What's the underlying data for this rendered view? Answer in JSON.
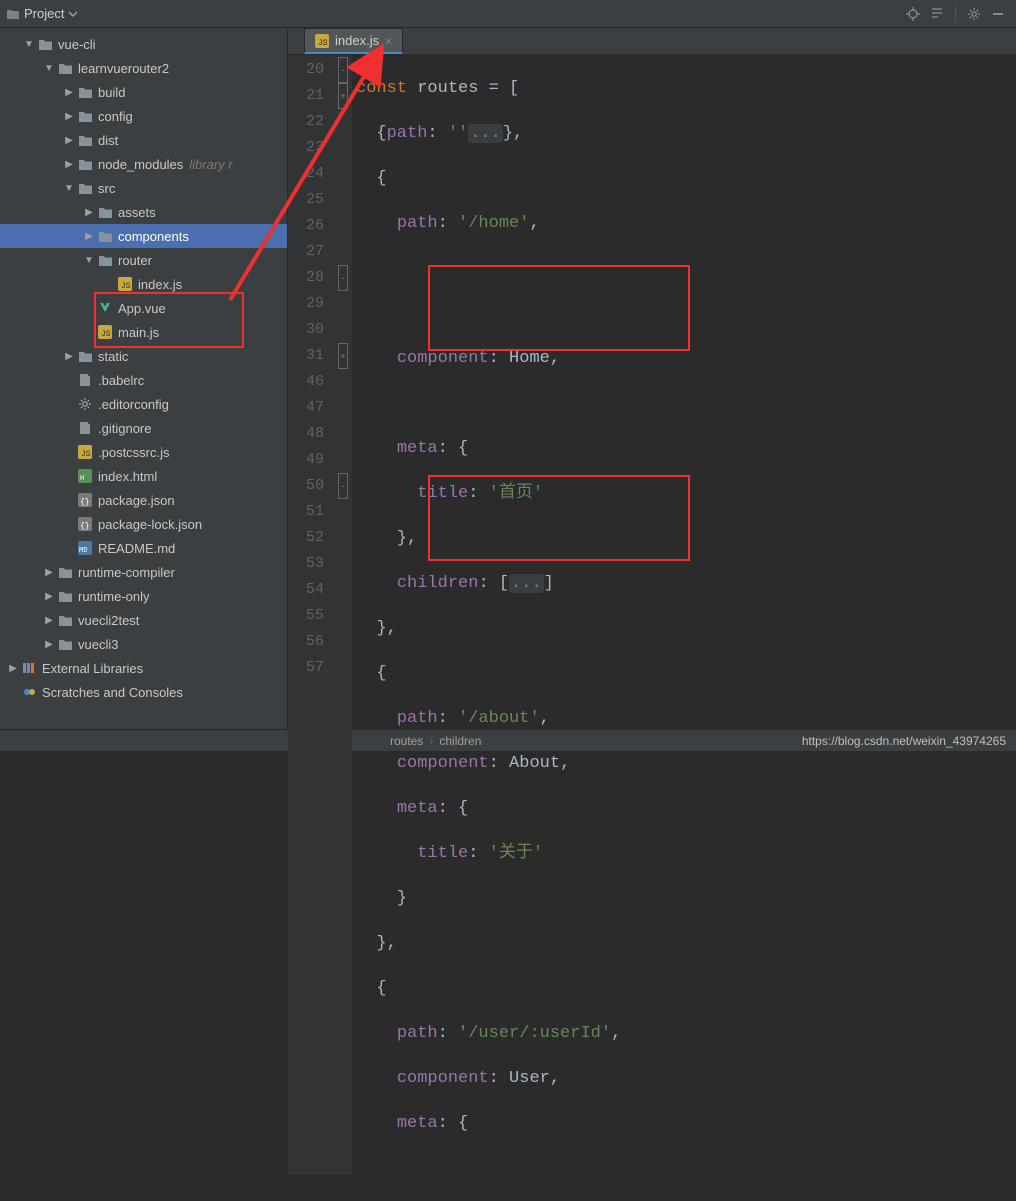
{
  "toolbar": {
    "title": "Project"
  },
  "tree": [
    {
      "ind": 1,
      "arrow": "down",
      "icon": "folder",
      "label": "vue-cli"
    },
    {
      "ind": 2,
      "arrow": "down",
      "icon": "folder",
      "label": "learnvuerouter2"
    },
    {
      "ind": 3,
      "arrow": "right",
      "icon": "folder",
      "label": "build"
    },
    {
      "ind": 3,
      "arrow": "right",
      "icon": "folder",
      "label": "config"
    },
    {
      "ind": 3,
      "arrow": "right",
      "icon": "folder",
      "label": "dist"
    },
    {
      "ind": 3,
      "arrow": "right",
      "icon": "folder",
      "label": "node_modules",
      "suffix": "library r"
    },
    {
      "ind": 3,
      "arrow": "down",
      "icon": "folder",
      "label": "src"
    },
    {
      "ind": 4,
      "arrow": "right",
      "icon": "folder",
      "label": "assets"
    },
    {
      "ind": 4,
      "arrow": "right",
      "icon": "folder",
      "label": "components",
      "selected": true
    },
    {
      "ind": 4,
      "arrow": "down",
      "icon": "folder",
      "label": "router"
    },
    {
      "ind": 5,
      "arrow": "none",
      "icon": "js",
      "label": "index.js"
    },
    {
      "ind": 4,
      "arrow": "none",
      "icon": "vue",
      "label": "App.vue"
    },
    {
      "ind": 4,
      "arrow": "none",
      "icon": "js",
      "label": "main.js"
    },
    {
      "ind": 3,
      "arrow": "right",
      "icon": "folder",
      "label": "static"
    },
    {
      "ind": 3,
      "arrow": "none",
      "icon": "file",
      "label": ".babelrc"
    },
    {
      "ind": 3,
      "arrow": "none",
      "icon": "gear",
      "label": ".editorconfig"
    },
    {
      "ind": 3,
      "arrow": "none",
      "icon": "file",
      "label": ".gitignore"
    },
    {
      "ind": 3,
      "arrow": "none",
      "icon": "js",
      "label": ".postcssrc.js"
    },
    {
      "ind": 3,
      "arrow": "none",
      "icon": "html",
      "label": "index.html"
    },
    {
      "ind": 3,
      "arrow": "none",
      "icon": "json",
      "label": "package.json"
    },
    {
      "ind": 3,
      "arrow": "none",
      "icon": "json",
      "label": "package-lock.json"
    },
    {
      "ind": 3,
      "arrow": "none",
      "icon": "md",
      "label": "README.md"
    },
    {
      "ind": 2,
      "arrow": "right",
      "icon": "folder",
      "label": "runtime-compiler"
    },
    {
      "ind": 2,
      "arrow": "right",
      "icon": "folder",
      "label": "runtime-only"
    },
    {
      "ind": 2,
      "arrow": "right",
      "icon": "folder",
      "label": "vuecli2test"
    },
    {
      "ind": 2,
      "arrow": "right",
      "icon": "folder",
      "label": "vuecli3"
    },
    {
      "ind": 0,
      "arrow": "right",
      "icon": "lib",
      "label": "External Libraries"
    },
    {
      "ind": 0,
      "arrow": "none",
      "icon": "scratch",
      "label": "Scratches and Consoles"
    }
  ],
  "tab": {
    "filename": "index.js"
  },
  "gutter": [
    "20",
    "21",
    "22",
    "23",
    "24",
    "25",
    "26",
    "27",
    "28",
    "29",
    "30",
    "31",
    "46",
    "47",
    "48",
    "49",
    "50",
    "51",
    "52",
    "53",
    "54",
    "55",
    "56",
    "57"
  ],
  "folds": [
    "-",
    "+",
    "",
    "",
    "",
    "",
    "",
    "",
    "-",
    "",
    "",
    "+",
    "",
    "",
    "",
    "",
    "-",
    "",
    "",
    "",
    "",
    "",
    "",
    ""
  ],
  "code": {
    "l20": {
      "kw": "const",
      "ident": " routes ",
      "eq": "= ["
    },
    "l21": {
      "open": "  {",
      "prop": "path",
      "colon": ": ",
      "str": "''",
      "fold": "...",
      "close": "},"
    },
    "l22": "  {",
    "l23": {
      "prop": "path",
      "colon": ": ",
      "str": "'/home'",
      "comma": ","
    },
    "l24": "",
    "l25": "",
    "l26": {
      "prop": "component",
      "colon": ": ",
      "ident": "Home",
      "comma": ","
    },
    "l27": "",
    "l28": {
      "prop": "meta",
      "colon": ": {"
    },
    "l29": {
      "prop": "title",
      "colon": ": ",
      "str": "'首页'"
    },
    "l30": "    },",
    "l31": {
      "prop": "children",
      "colon": ": [",
      "fold": "...",
      "close": "]"
    },
    "l46": "  },",
    "l47": "  {",
    "l48": {
      "prop": "path",
      "colon": ": ",
      "str": "'/about'",
      "comma": ","
    },
    "l49": {
      "prop": "component",
      "colon": ": ",
      "ident": "About",
      "comma": ","
    },
    "l50": {
      "prop": "meta",
      "colon": ": {"
    },
    "l51": {
      "prop": "title",
      "colon": ": ",
      "str": "'关于'"
    },
    "l52": "    }",
    "l53": "  },",
    "l54": "  {",
    "l55": {
      "prop": "path",
      "colon": ": ",
      "str": "'/user/:userId'",
      "comma": ","
    },
    "l56": {
      "prop": "component",
      "colon": ": ",
      "ident": "User",
      "comma": ","
    },
    "l57": {
      "prop": "meta",
      "colon": ": {"
    }
  },
  "breadcrumb": {
    "a": "routes",
    "b": "children"
  },
  "watermark": "https://blog.csdn.net/weixin_43974265"
}
